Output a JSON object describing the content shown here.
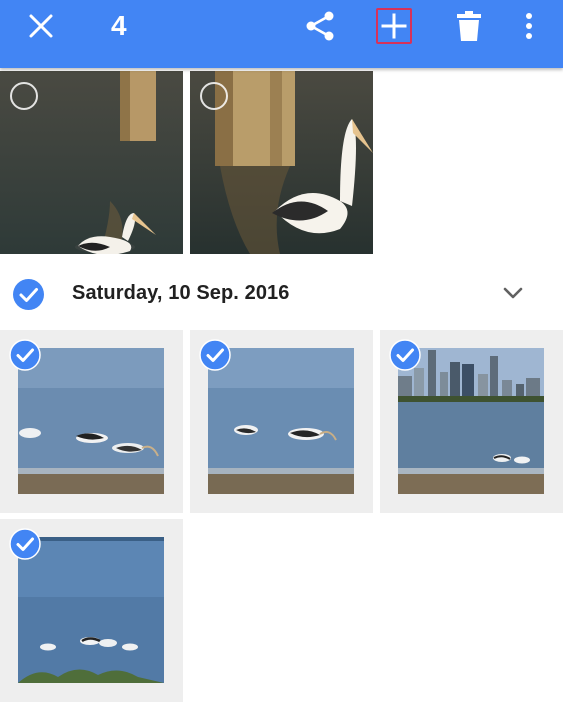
{
  "toolbar": {
    "selected_count": "4",
    "icons": [
      "close-icon",
      "share-icon",
      "add-icon",
      "delete-icon",
      "more-vert-icon"
    ],
    "accent_color": "#4285f4",
    "highlight_color": "#d8325a"
  },
  "section": {
    "date_label": "Saturday, 10 Sep. 2016",
    "selected": true
  },
  "photos": {
    "unselected_count": 2,
    "selected_count": 4
  }
}
